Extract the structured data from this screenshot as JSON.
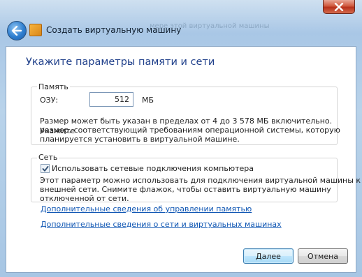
{
  "window": {
    "title": "Создать виртуальную машину",
    "background_text": "мере этой виртуальной машины"
  },
  "page": {
    "heading": "Укажите параметры памяти и сети"
  },
  "memory": {
    "group_label": "Память",
    "ram_label": "ОЗУ:",
    "ram_value": "512",
    "unit": "МБ",
    "hint_line1": "Размер может быть указан в пределах от 4 до 3 578 МБ включительно. Укажите",
    "hint_line2": "размер, соответствующий требованиям операционной системы, которую",
    "hint_line3": "планируется установить в виртуальной машине."
  },
  "network": {
    "group_label": "Сеть",
    "checkbox_label": "Использовать сетевые подключения компьютера",
    "checkbox_checked": true,
    "hint_line1": "Этот параметр можно использовать для подключения виртуальной машины к",
    "hint_line2": "внешней сети. Снимите флажок, чтобы оставить виртуальную машину",
    "hint_line3": "отключенной от сети."
  },
  "links": {
    "memory_info": "Дополнительные сведения об управлении памятью",
    "network_info": "Дополнительные сведения о сети и виртуальных машинах"
  },
  "buttons": {
    "next": "Далее",
    "cancel": "Отмена"
  },
  "icons": {
    "back": "back-arrow-icon",
    "close": "close-icon",
    "window": "virtual-machine-icon",
    "check": "checkmark-icon"
  },
  "colors": {
    "heading": "#1f3f8a",
    "link": "#0f56b3",
    "close_button": "#c8452b",
    "back_button": "#2e7ecf"
  }
}
